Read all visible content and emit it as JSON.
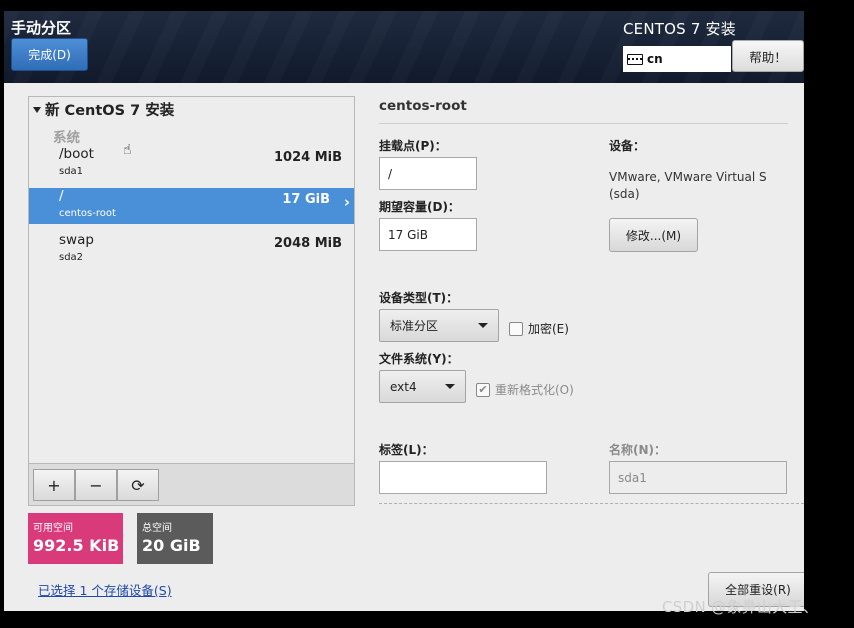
{
  "header": {
    "title": "手动分区",
    "done_label": "完成(D)",
    "product": "CENTOS 7 安装",
    "keyboard_layout": "cn",
    "help_label": "帮助！"
  },
  "partitions": {
    "install_title": "新 CentOS 7 安装",
    "system_header": "系统",
    "items": [
      {
        "mount": "/boot",
        "device": "sda1",
        "size": "1024 MiB",
        "selected": false
      },
      {
        "mount": "/",
        "device": "centos-root",
        "size": "17 GiB",
        "selected": true
      },
      {
        "mount": "swap",
        "device": "sda2",
        "size": "2048 MiB",
        "selected": false
      }
    ],
    "toolbar": {
      "add": "+",
      "remove": "−",
      "refresh": "⟳"
    }
  },
  "space": {
    "free_label": "可用空间",
    "free_value": "992.5 KiB",
    "total_label": "总空间",
    "total_value": "20 GiB"
  },
  "storage_link": "已选择 1 个存储设备(S)",
  "detail": {
    "title": "centos-root",
    "mount_label": "挂载点(P)：",
    "mount_value": "/",
    "capacity_label": "期望容量(D)：",
    "capacity_value": "17 GiB",
    "device_label": "设备：",
    "device_value": "VMware, VMware Virtual S\n(sda)",
    "modify_label": "修改...(M)",
    "device_type_label": "设备类型(T)：",
    "device_type_value": "标准分区",
    "encrypt_label": "加密(E)",
    "fs_label": "文件系统(Y)：",
    "fs_value": "ext4",
    "reformat_label": "重新格式化(O)",
    "tag_label": "标签(L)：",
    "tag_value": "",
    "name_label": "名称(N)：",
    "name_value": "sda1",
    "reset_label": "全部重设(R)"
  },
  "watermark": "CSDN @象鼻山大王、",
  "colors": {
    "accent": "#4a90d9",
    "free_space": "#d93a7a",
    "total_space": "#5b5b5b",
    "header_bg": "#1a2438"
  }
}
